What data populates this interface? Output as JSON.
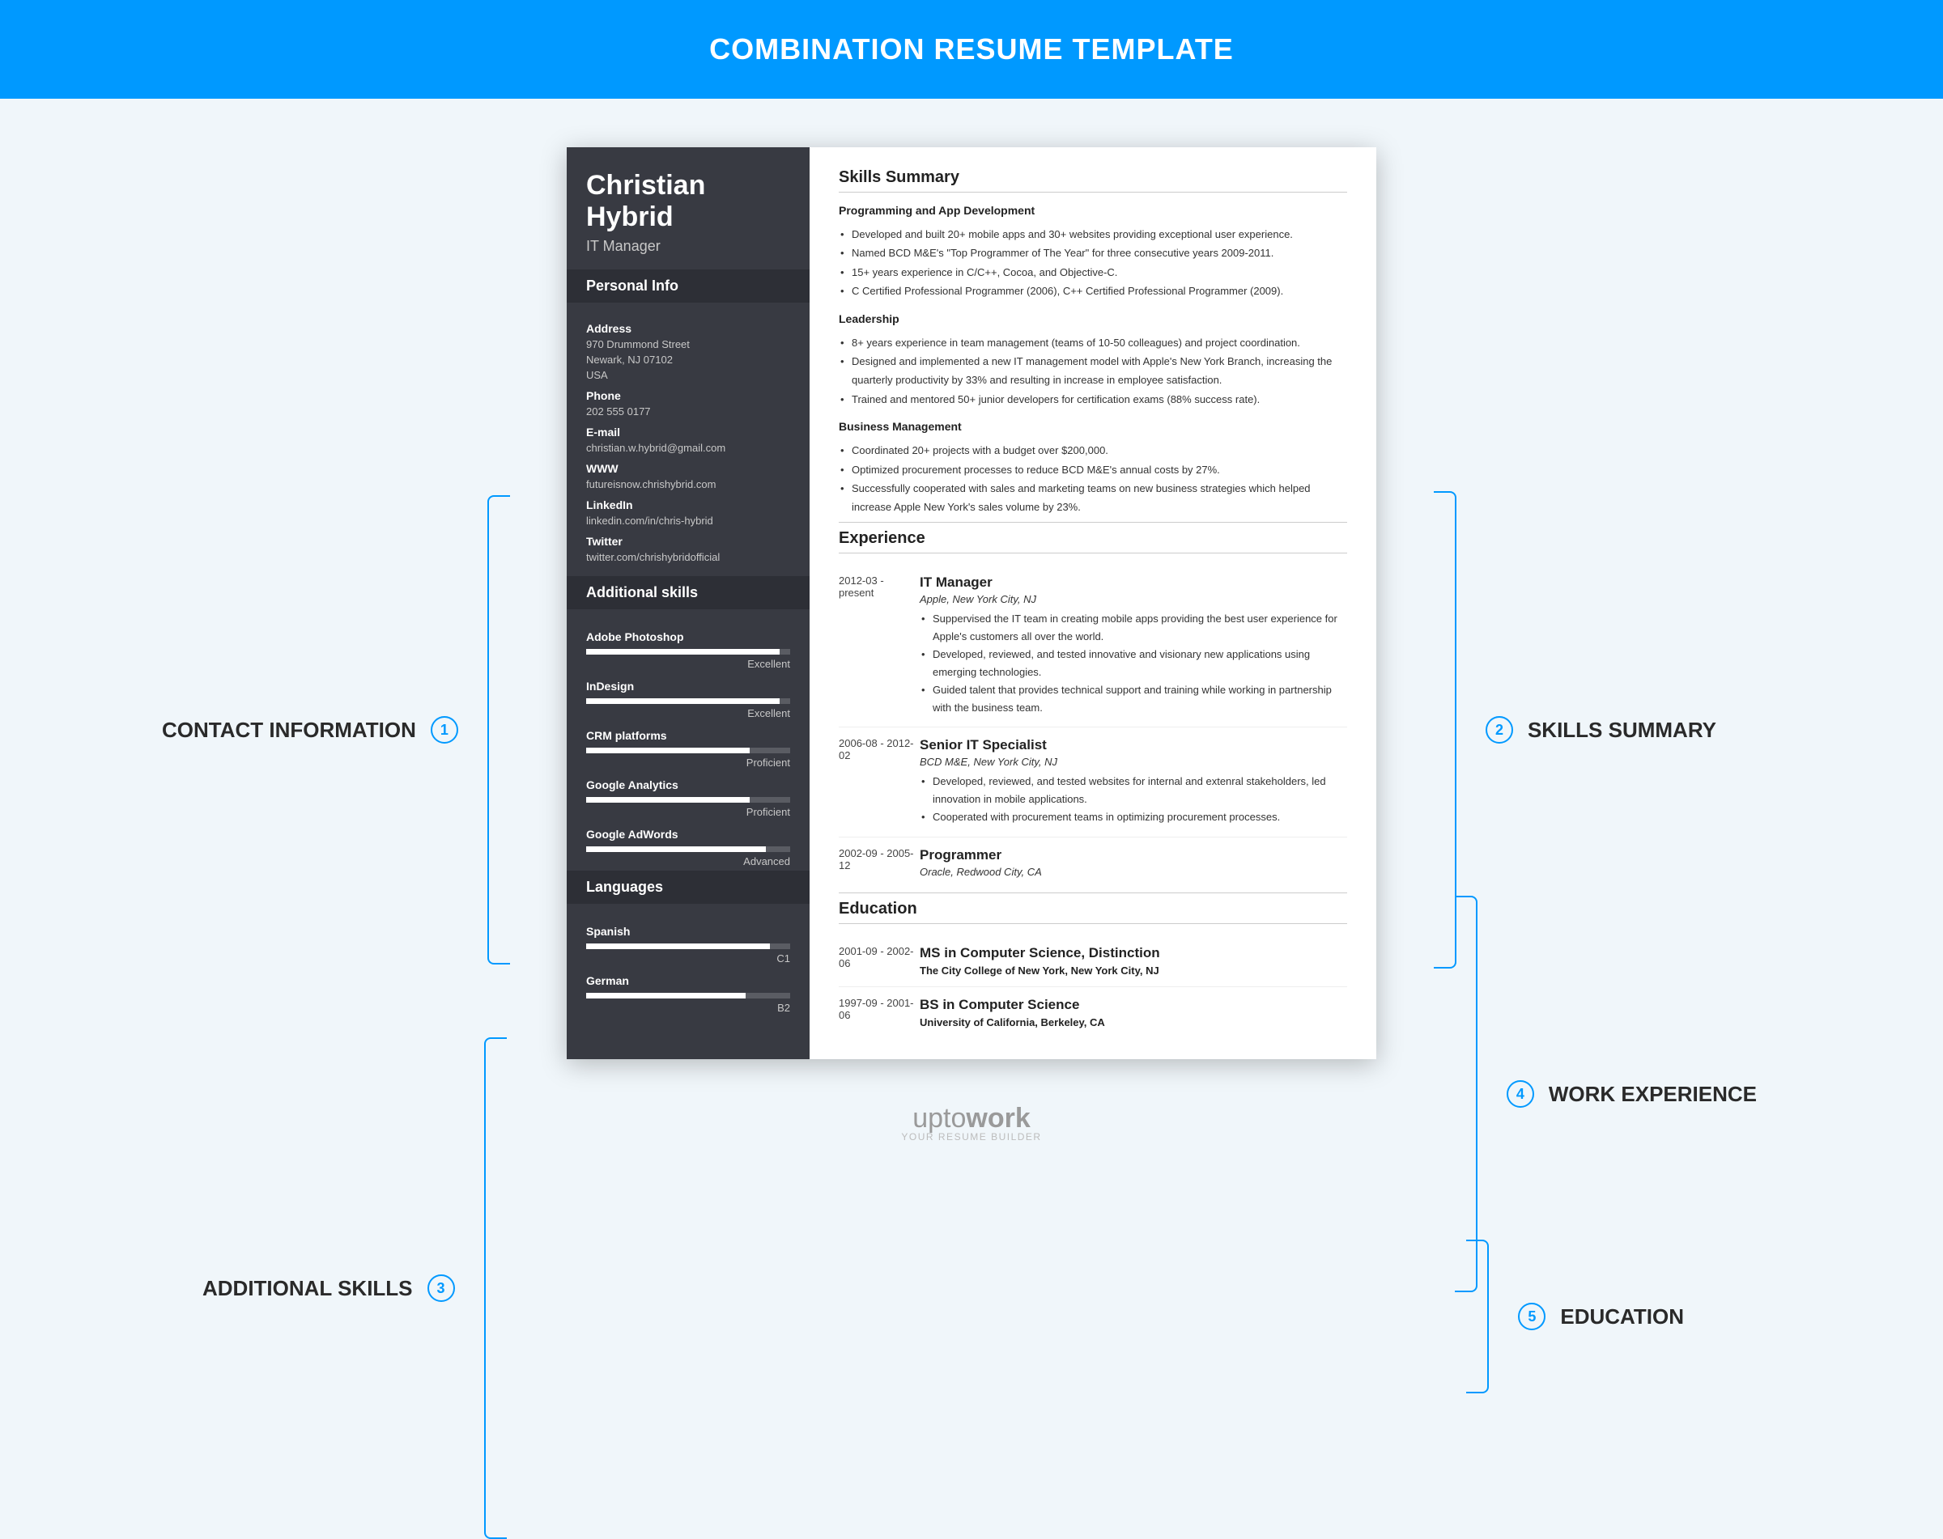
{
  "header": {
    "title": "COMBINATION RESUME TEMPLATE"
  },
  "annotations": {
    "contact": {
      "num": "1",
      "label": "CONTACT INFORMATION"
    },
    "skills_summary": {
      "num": "2",
      "label": "SKILLS SUMMARY"
    },
    "additional_skills": {
      "num": "3",
      "label": "ADDITIONAL SKILLS"
    },
    "work_experience": {
      "num": "4",
      "label": "WORK EXPERIENCE"
    },
    "education": {
      "num": "5",
      "label": "EDUCATION"
    }
  },
  "resume": {
    "name": "Christian Hybrid",
    "title": "IT Manager",
    "personal_info_heading": "Personal Info",
    "info": {
      "address_label": "Address",
      "address_line1": "970 Drummond Street",
      "address_line2": "Newark, NJ 07102",
      "address_line3": "USA",
      "phone_label": "Phone",
      "phone": "202 555 0177",
      "email_label": "E-mail",
      "email": "christian.w.hybrid@gmail.com",
      "www_label": "WWW",
      "www": "futureisnow.chrishybrid.com",
      "linkedin_label": "LinkedIn",
      "linkedin": "linkedin.com/in/chris-hybrid",
      "twitter_label": "Twitter",
      "twitter": "twitter.com/chrishybridofficial"
    },
    "additional_skills_heading": "Additional skills",
    "skills": [
      {
        "name": "Adobe Photoshop",
        "level": "Excellent",
        "pct": 95
      },
      {
        "name": "InDesign",
        "level": "Excellent",
        "pct": 95
      },
      {
        "name": "CRM platforms",
        "level": "Proficient",
        "pct": 80
      },
      {
        "name": "Google Analytics",
        "level": "Proficient",
        "pct": 80
      },
      {
        "name": "Google AdWords",
        "level": "Advanced",
        "pct": 88
      }
    ],
    "languages_heading": "Languages",
    "languages": [
      {
        "name": "Spanish",
        "level": "C1",
        "pct": 90
      },
      {
        "name": "German",
        "level": "B2",
        "pct": 78
      }
    ],
    "skills_summary_heading": "Skills Summary",
    "summary_groups": [
      {
        "title": "Programming and App Development",
        "items": [
          "Developed and built 20+ mobile apps and 30+ websites providing exceptional user experience.",
          "Named BCD M&E's \"Top Programmer of The Year\" for three consecutive years 2009-2011.",
          "15+ years experience in C/C++, Cocoa, and Objective-C.",
          "C Certified Professional Programmer (2006), C++ Certified Professional Programmer (2009)."
        ]
      },
      {
        "title": "Leadership",
        "items": [
          "8+ years experience in team management (teams of 10-50 colleagues) and project coordination.",
          "Designed and implemented a new IT management model with Apple's New York Branch, increasing the quarterly productivity by 33% and resulting in increase in employee satisfaction.",
          "Trained and mentored 50+ junior developers for certification exams (88% success rate)."
        ]
      },
      {
        "title": "Business Management",
        "items": [
          "Coordinated 20+ projects with a budget over $200,000.",
          "Optimized procurement processes to reduce BCD M&E's annual costs by 27%.",
          "Successfully cooperated with sales and marketing teams on new business strategies which helped increase Apple New York's sales volume by 23%."
        ]
      }
    ],
    "experience_heading": "Experience",
    "experience": [
      {
        "date": "2012-03 - present",
        "title": "IT Manager",
        "company": "Apple, New York City, NJ",
        "bullets": [
          "Suppervised the IT team in creating mobile apps providing the best user experience for Apple's customers all over the world.",
          "Developed, reviewed, and tested innovative and visionary new applications using emerging technologies.",
          "Guided talent that provides technical support and training while working in partnership with the business team."
        ]
      },
      {
        "date": "2006-08 - 2012-02",
        "title": "Senior IT Specialist",
        "company": "BCD M&E, New York City, NJ",
        "bullets": [
          "Developed, reviewed, and tested websites for internal and extenral stakeholders, led innovation in mobile applications.",
          "Cooperated with procurement teams in optimizing procurement processes."
        ]
      },
      {
        "date": "2002-09 - 2005-12",
        "title": "Programmer",
        "company": "Oracle, Redwood City, CA",
        "bullets": []
      }
    ],
    "education_heading": "Education",
    "education": [
      {
        "date": "2001-09 - 2002-06",
        "title": "MS in Computer Science, Distinction",
        "school": "The City College of New York, New York City, NJ"
      },
      {
        "date": "1997-09 - 2001-06",
        "title": "BS in Computer Science",
        "school": "University of California, Berkeley, CA"
      }
    ]
  },
  "footer": {
    "brand1": "upto",
    "brand2": "work",
    "tag": "YOUR RESUME BUILDER"
  }
}
